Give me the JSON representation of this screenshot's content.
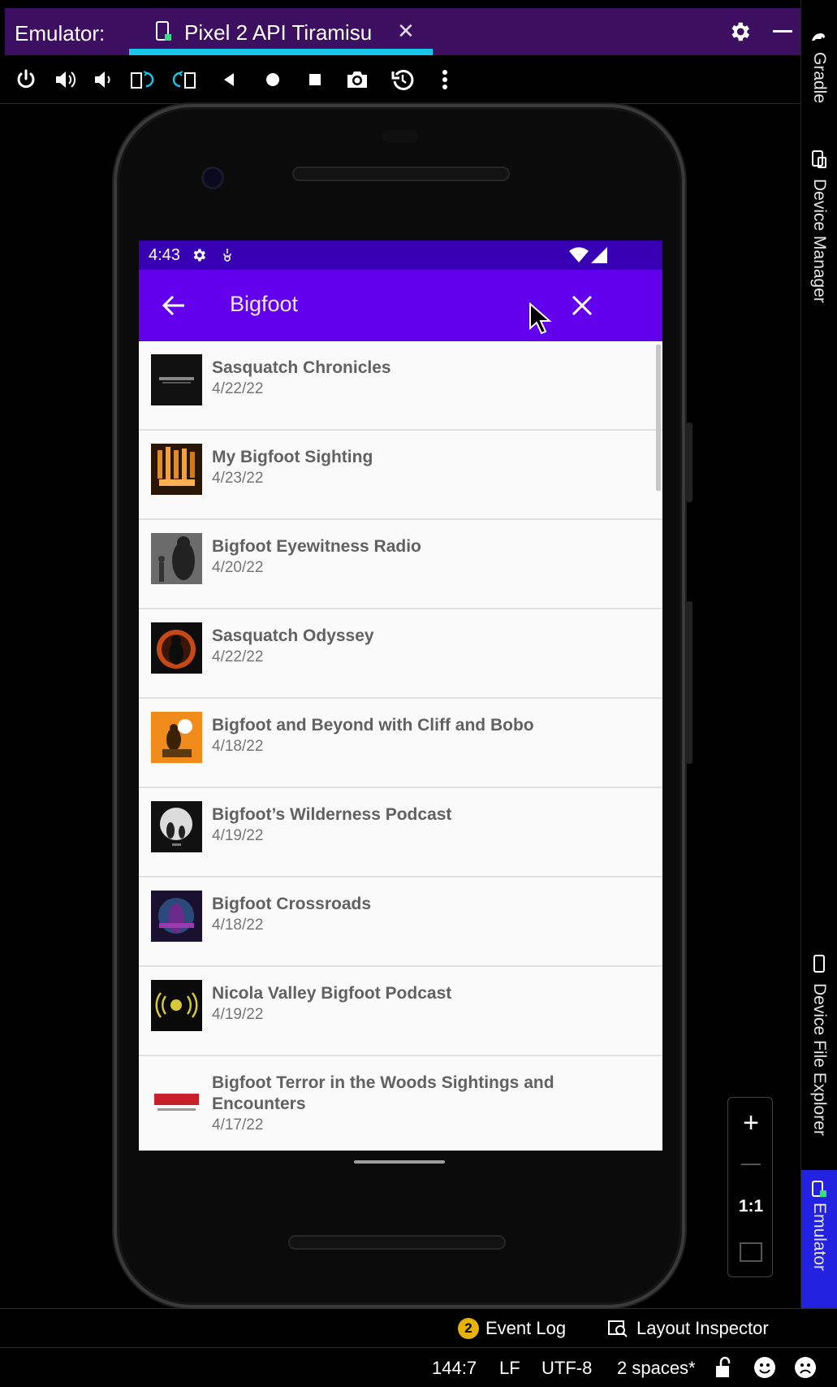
{
  "ide": {
    "panel_label": "Emulator:",
    "tab_label": "Pixel 2 API Tiramisu",
    "tab_close": "✕",
    "toolbar_icons": [
      "power-icon",
      "volume-up-icon",
      "volume-down-icon",
      "rotate-left-icon",
      "rotate-right-icon",
      "back-icon",
      "home-icon",
      "overview-icon",
      "camera-icon",
      "snapshot-icon",
      "more-icon"
    ],
    "right_tools": {
      "gradle": "Gradle",
      "device_manager": "Device Manager",
      "device_file_explorer": "Device File Explorer",
      "emulator": "Emulator"
    },
    "tool_windows": {
      "event_log_badge": "2",
      "event_log": "Event Log",
      "layout_inspector": "Layout Inspector"
    },
    "status": {
      "position": "144:7",
      "line_sep": "LF",
      "encoding": "UTF-8",
      "indent": "2 spaces*"
    },
    "zoom": {
      "plus": "+",
      "one_to_one": "1:1"
    }
  },
  "device": {
    "time": "4:43",
    "search_query": "Bigfoot",
    "colors": {
      "status_bar": "#3700b3",
      "app_bar": "#6200ee"
    },
    "results": [
      {
        "title": "Sasquatch Chronicles",
        "date": "4/22/22"
      },
      {
        "title": "My Bigfoot Sighting",
        "date": "4/23/22"
      },
      {
        "title": "Bigfoot Eyewitness Radio",
        "date": "4/20/22"
      },
      {
        "title": "Sasquatch Odyssey",
        "date": "4/22/22"
      },
      {
        "title": "Bigfoot and Beyond with Cliff and Bobo",
        "date": "4/18/22"
      },
      {
        "title": "Bigfoot’s Wilderness Podcast",
        "date": "4/19/22"
      },
      {
        "title": "Bigfoot Crossroads",
        "date": "4/18/22"
      },
      {
        "title": "Nicola Valley Bigfoot Podcast",
        "date": "4/19/22"
      },
      {
        "title": "Bigfoot Terror in the Woods Sightings and Encounters",
        "date": "4/17/22"
      }
    ]
  }
}
